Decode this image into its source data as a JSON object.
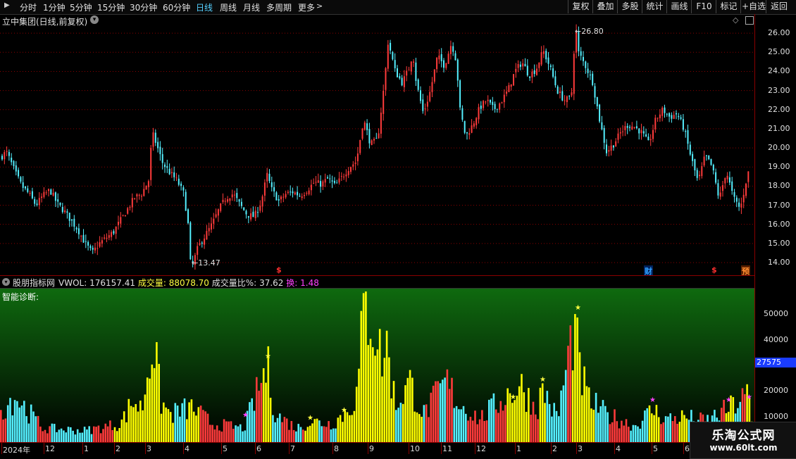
{
  "toolbar": {
    "periods": [
      "分时",
      "1分钟",
      "5分钟",
      "15分钟",
      "30分钟",
      "60分钟",
      "日线",
      "周线",
      "月线",
      "多周期",
      "更多"
    ],
    "active_period": "日线",
    "buttons": [
      "复权",
      "叠加",
      "多股",
      "统计",
      "画线",
      "F10",
      "标记",
      "+自选",
      "返回"
    ]
  },
  "main_chart": {
    "title": "立中集团(日线,前复权)",
    "high_label": "26.80",
    "low_label": "13.47",
    "yticks": [
      "26.00",
      "25.00",
      "24.00",
      "23.00",
      "22.00",
      "21.00",
      "20.00",
      "19.00",
      "18.00",
      "17.00",
      "16.00",
      "15.00",
      "14.00"
    ],
    "markers": [
      {
        "text": "$",
        "color": "#ff3030"
      },
      {
        "text": "财",
        "color": "#30a0ff"
      },
      {
        "text": "$",
        "color": "#ff3030"
      },
      {
        "text": "预",
        "color": "#ff8c30"
      }
    ]
  },
  "indicator": {
    "name": "股朋指标网",
    "params": [
      {
        "label": "VWOL:",
        "value": "176157.41",
        "color": "#e0e0e0"
      },
      {
        "label": "成交量:",
        "value": "88078.70",
        "color": "#ffff40"
      },
      {
        "label": "成交量比%:",
        "value": "37.62",
        "color": "#e0e0e0"
      },
      {
        "label": "换:",
        "value": "1.48",
        "color": "#ff40ff"
      }
    ],
    "diagnosis_label": "智能诊断:",
    "yticks": [
      "50000",
      "40000",
      "30000",
      "20000",
      "10000"
    ],
    "current_value": "27575"
  },
  "xaxis": [
    "2024年",
    "12",
    "1",
    "2",
    "3",
    "4",
    "5",
    "6",
    "7",
    "8",
    "9",
    "10",
    "11",
    "12",
    "1",
    "2",
    "3",
    "4",
    "5",
    "6"
  ],
  "watermark": {
    "title": "乐淘公式网",
    "url": "www.60lt.com"
  },
  "colors": {
    "up": "#ff3b3b",
    "down": "#54f0ff",
    "volume_highlight": "#ffff00",
    "grid": "#8b0000"
  },
  "chart_data": {
    "type": "candlestick",
    "title": "立中集团(日线,前复权)",
    "ylim": [
      13.3,
      27.0
    ],
    "close_path": [
      [
        0,
        19.5
      ],
      [
        8,
        19.8
      ],
      [
        15,
        19.2
      ],
      [
        22,
        18.6
      ],
      [
        30,
        18.0
      ],
      [
        40,
        17.6
      ],
      [
        50,
        17.0
      ],
      [
        60,
        17.5
      ],
      [
        70,
        17.8
      ],
      [
        80,
        17.1
      ],
      [
        90,
        16.7
      ],
      [
        100,
        16.2
      ],
      [
        110,
        15.7
      ],
      [
        120,
        15.0
      ],
      [
        130,
        14.5
      ],
      [
        140,
        15.0
      ],
      [
        150,
        15.3
      ],
      [
        160,
        15.6
      ],
      [
        170,
        16.2
      ],
      [
        180,
        16.8
      ],
      [
        190,
        17.4
      ],
      [
        200,
        17.6
      ],
      [
        210,
        18.3
      ],
      [
        215,
        20.8
      ],
      [
        220,
        20.3
      ],
      [
        230,
        19.2
      ],
      [
        240,
        18.7
      ],
      [
        250,
        18.3
      ],
      [
        260,
        17.6
      ],
      [
        266,
        16.0
      ],
      [
        270,
        13.6
      ],
      [
        280,
        14.8
      ],
      [
        290,
        15.4
      ],
      [
        300,
        16.0
      ],
      [
        310,
        16.8
      ],
      [
        320,
        17.4
      ],
      [
        330,
        17.6
      ],
      [
        340,
        17.0
      ],
      [
        350,
        16.5
      ],
      [
        360,
        16.4
      ],
      [
        370,
        17.2
      ],
      [
        378,
        18.6
      ],
      [
        385,
        17.8
      ],
      [
        395,
        17.2
      ],
      [
        405,
        17.6
      ],
      [
        415,
        17.7
      ],
      [
        425,
        17.5
      ],
      [
        435,
        17.8
      ],
      [
        445,
        18.2
      ],
      [
        455,
        18.1
      ],
      [
        465,
        18.4
      ],
      [
        475,
        18.0
      ],
      [
        485,
        18.5
      ],
      [
        495,
        19.0
      ],
      [
        505,
        19.3
      ],
      [
        515,
        21.5
      ],
      [
        525,
        20.2
      ],
      [
        535,
        20.4
      ],
      [
        545,
        23.5
      ],
      [
        550,
        25.6
      ],
      [
        560,
        24.0
      ],
      [
        570,
        23.4
      ],
      [
        580,
        24.2
      ],
      [
        585,
        25.0
      ],
      [
        590,
        23.4
      ],
      [
        600,
        21.8
      ],
      [
        610,
        23.0
      ],
      [
        620,
        24.8
      ],
      [
        630,
        24.3
      ],
      [
        640,
        25.5
      ],
      [
        647,
        24.5
      ],
      [
        652,
        22.0
      ],
      [
        660,
        20.6
      ],
      [
        670,
        21.2
      ],
      [
        680,
        22.1
      ],
      [
        690,
        22.5
      ],
      [
        700,
        22.0
      ],
      [
        710,
        22.4
      ],
      [
        720,
        23.0
      ],
      [
        730,
        24.0
      ],
      [
        740,
        24.5
      ],
      [
        750,
        23.8
      ],
      [
        760,
        24.1
      ],
      [
        770,
        25.1
      ],
      [
        780,
        24.2
      ],
      [
        790,
        23.0
      ],
      [
        800,
        22.5
      ],
      [
        810,
        22.6
      ],
      [
        816,
        26.5
      ],
      [
        820,
        25.0
      ],
      [
        830,
        24.3
      ],
      [
        840,
        23.5
      ],
      [
        850,
        21.5
      ],
      [
        860,
        19.8
      ],
      [
        870,
        20.2
      ],
      [
        880,
        20.8
      ],
      [
        890,
        21.2
      ],
      [
        900,
        21.1
      ],
      [
        910,
        20.8
      ],
      [
        920,
        20.2
      ],
      [
        930,
        21.5
      ],
      [
        940,
        22.0
      ],
      [
        950,
        21.6
      ],
      [
        960,
        21.8
      ],
      [
        970,
        21.0
      ],
      [
        980,
        19.5
      ],
      [
        990,
        18.2
      ],
      [
        1000,
        19.6
      ],
      [
        1010,
        19.0
      ],
      [
        1020,
        17.3
      ],
      [
        1030,
        18.8
      ],
      [
        1040,
        17.4
      ],
      [
        1050,
        16.8
      ],
      [
        1060,
        18.6
      ],
      [
        1065,
        19.0
      ]
    ]
  }
}
